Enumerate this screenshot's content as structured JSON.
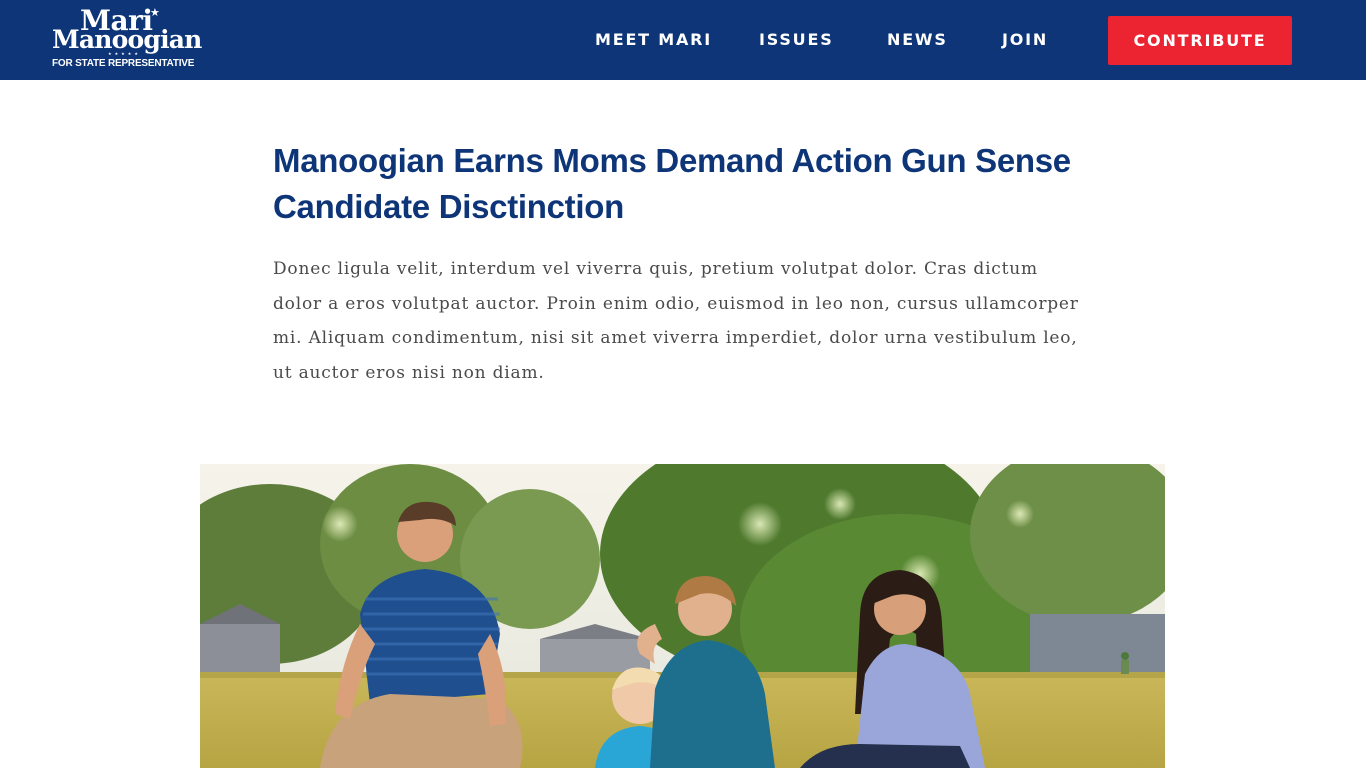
{
  "logo": {
    "first_name": "Mari",
    "last_name": "Manoogian",
    "tagline": "FOR STATE REPRESENTATIVE",
    "star": "★",
    "stars_row": "★★★★★"
  },
  "nav": {
    "items": [
      {
        "label": "MEET MARI"
      },
      {
        "label": "ISSUES"
      },
      {
        "label": "NEWS"
      },
      {
        "label": "JOIN"
      }
    ],
    "contribute_label": "CONTRIBUTE"
  },
  "article": {
    "title": "Manoogian Earns Moms Demand Action Gun Sense Candidate Disctinction",
    "body": "Donec ligula velit, interdum vel viverra quis, pretium volutpat dolor. Cras dictum dolor a eros volutpat auctor. Proin enim odio, euismod in leo non, cursus ullamcorper mi. Aliquam condimentum, nisi sit amet viverra imperdiet, dolor urna vestibulum leo, ut auctor eros nisi non diam."
  },
  "colors": {
    "header_bg": "#0d3578",
    "contribute_bg": "#ec2330",
    "title": "#0d3578",
    "body_text": "#4a4a4a"
  }
}
